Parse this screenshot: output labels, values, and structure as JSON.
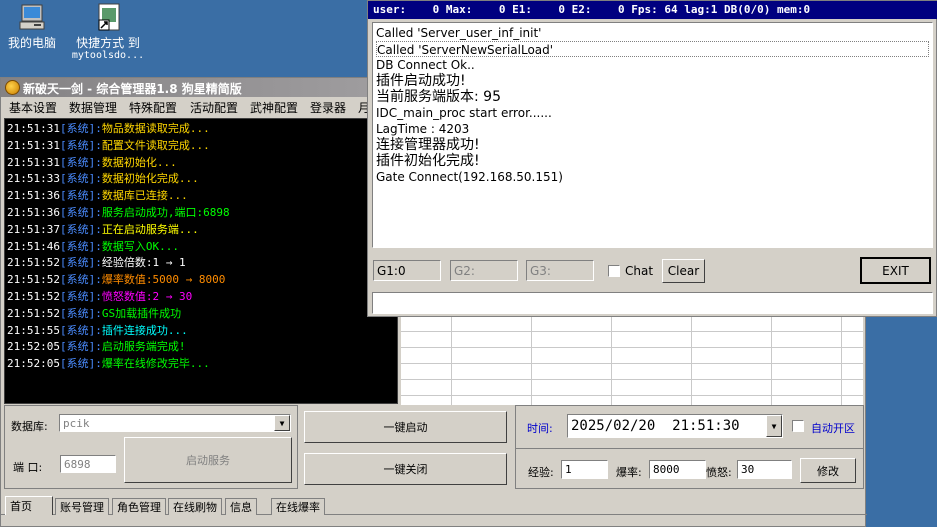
{
  "desktop": {
    "icons": [
      {
        "label": "我的电脑",
        "label2": ""
      },
      {
        "label": "快捷方式 到",
        "label2": "mytoolsdo..."
      }
    ]
  },
  "manager": {
    "title": "新破天一剑 - 综合管理器1.8 狗星精简版",
    "menu": [
      "基本设置",
      "数据管理",
      "特殊配置",
      "活动配置",
      "武神配置",
      "登录器",
      "月"
    ],
    "console": [
      {
        "time": "21:51:31",
        "tag": "[系统]:",
        "msg": "物品数据读取完成...",
        "color": "#ffd700"
      },
      {
        "time": "21:51:31",
        "tag": "[系统]:",
        "msg": "配置文件读取完成...",
        "color": "#ffd700"
      },
      {
        "time": "21:51:31",
        "tag": "[系统]:",
        "msg": "数据初始化...",
        "color": "#ffd700"
      },
      {
        "time": "21:51:33",
        "tag": "[系统]:",
        "msg": "数据初始化完成...",
        "color": "#ffd700"
      },
      {
        "time": "21:51:36",
        "tag": "[系统]:",
        "msg": "数据库已连接...",
        "color": "#ffd700"
      },
      {
        "time": "21:51:36",
        "tag": "[系统]:",
        "msg": "服务启动成功,端口:6898",
        "color": "#00ff00"
      },
      {
        "time": "21:51:37",
        "tag": "[系统]:",
        "msg": "正在启动服务端...",
        "color": "#ffff00"
      },
      {
        "time": "21:51:46",
        "tag": "[系统]:",
        "msg": "数据写入OK...",
        "color": "#00ff00"
      },
      {
        "time": "21:51:52",
        "tag": "[系统]:",
        "msg": "经验倍数:1 → 1",
        "color": "#ffffff"
      },
      {
        "time": "21:51:52",
        "tag": "[系统]:",
        "msg": "爆率数值:5000 → 8000",
        "color": "#ff8c00"
      },
      {
        "time": "21:51:52",
        "tag": "[系统]:",
        "msg": "愤怒数值:2 → 30",
        "color": "#ff00ff"
      },
      {
        "time": "21:51:52",
        "tag": "[系统]:",
        "msg": "GS加载插件成功",
        "color": "#00ff00"
      },
      {
        "time": "21:51:55",
        "tag": "[系统]:",
        "msg": "插件连接成功...",
        "color": "#00ffff"
      },
      {
        "time": "21:52:05",
        "tag": "[系统]:",
        "msg": "启动服务端完成!",
        "color": "#00ff00"
      },
      {
        "time": "21:52:05",
        "tag": "[系统]:",
        "msg": "爆率在线修改完毕...",
        "color": "#00ff00"
      }
    ],
    "db_label": "数据库:",
    "db_value": "pcik",
    "port_label": "端  口:",
    "port_value": "6898",
    "start_service_button": "启动服务",
    "one_key_start_button": "一键启动",
    "one_key_close_button": "一键关闭",
    "time_label": "时间:",
    "time_value": "2025/02/20  21:51:30",
    "auto_open_label": "自动开区",
    "exp_label": "经验:",
    "exp_value": "1",
    "drop_label": "爆率:",
    "drop_value": "8000",
    "rage_label": "愤怒:",
    "rage_value": "30",
    "modify_button": "修改",
    "tabs": [
      "首页",
      "账号管理",
      "角色管理",
      "在线刷物",
      "信息",
      "在线爆率"
    ]
  },
  "server": {
    "status_bar": "user:    0 Max:    0 E1:    0 E2:    0 Fps: 64 lag:1 DB(0/0) mem:0",
    "log": [
      {
        "text": "Called 'Server_user_inf_init'",
        "zh": false,
        "boxed": false
      },
      {
        "text": "Called 'ServerNewSerialLoad'",
        "zh": false,
        "boxed": true
      },
      {
        "text": "DB Connect Ok..",
        "zh": false,
        "boxed": false
      },
      {
        "text": "插件启动成功!",
        "zh": true,
        "boxed": false
      },
      {
        "text": "当前服务端版本: 95",
        "zh": true,
        "boxed": false
      },
      {
        "text": "IDC_main_proc start error......",
        "zh": false,
        "boxed": false
      },
      {
        "text": "LagTime : 4203",
        "zh": false,
        "boxed": false
      },
      {
        "text": "连接管理器成功!",
        "zh": true,
        "boxed": false
      },
      {
        "text": "插件初始化完成!",
        "zh": true,
        "boxed": false
      },
      {
        "text": "Gate Connect(192.168.50.151)",
        "zh": false,
        "boxed": false
      }
    ],
    "g1": "G1:0",
    "g2": "G2:",
    "g3": "G3:",
    "chat_label": "Chat",
    "clear_button": "Clear",
    "exit_button": "EXIT"
  }
}
